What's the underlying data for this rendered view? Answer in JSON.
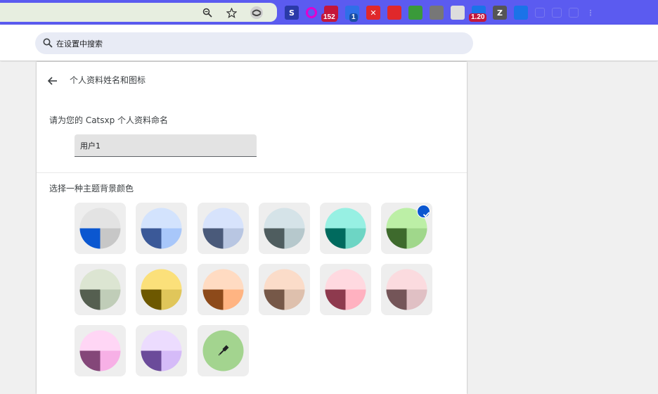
{
  "search": {
    "placeholder": "在设置中搜索"
  },
  "toolbar": {
    "extensions": [
      {
        "icon": "s-extension-icon",
        "color": "#2a3aa8",
        "text": "S"
      },
      {
        "icon": "ring-extension-icon",
        "color": "#e000d0",
        "text": ""
      },
      {
        "icon": "mail-extension-icon",
        "color": "#c4163a",
        "badge": "152"
      },
      {
        "icon": "folder-extension-icon",
        "color": "#2f6fe8",
        "badge": "1"
      },
      {
        "icon": "x-extension-icon",
        "color": "#e0282a",
        "text": "✕"
      },
      {
        "icon": "red-app-extension-icon",
        "color": "#e0282a",
        "text": ""
      },
      {
        "icon": "green-arrow-extension-icon",
        "color": "#3a9a3a",
        "text": ""
      },
      {
        "icon": "owl-extension-icon",
        "color": "#777777",
        "text": ""
      },
      {
        "icon": "bilibili-extension-icon",
        "color": "#dddddd",
        "text": ""
      },
      {
        "icon": "video-speed-extension-icon",
        "color": "#1a73e8",
        "badge": "1.20"
      },
      {
        "icon": "z-extension-icon",
        "color": "#555555",
        "text": "Z"
      },
      {
        "icon": "sync-extension-icon",
        "color": "#1a73e8",
        "text": ""
      },
      {
        "icon": "puzzle-extension-icon",
        "color": "#4d4de8",
        "text": ""
      },
      {
        "icon": "sidebar-icon",
        "color": "#4d4de8",
        "text": ""
      },
      {
        "icon": "download-icon",
        "color": "#4d4de8",
        "text": ""
      },
      {
        "icon": "more-menu-icon",
        "color": "#4d4de8",
        "text": "⋮"
      }
    ]
  },
  "page": {
    "title": "个人资料姓名和图标",
    "name_label": "请为您的 Catsxp 个人资料命名",
    "name_value": "用户1",
    "theme_label": "选择一种主题背景颜色"
  },
  "themes": [
    {
      "name": "default",
      "top": "#e3e3e3",
      "left": "#0b57d0",
      "right": "#c7c7c7",
      "selected": false
    },
    {
      "name": "light-blue",
      "top": "#d3e3fd",
      "left": "#3b5998",
      "right": "#a8c7fa",
      "selected": false
    },
    {
      "name": "periwinkle",
      "top": "#d7e3fc",
      "left": "#4a5a7a",
      "right": "#b8c6e2",
      "selected": false
    },
    {
      "name": "gray-blue",
      "top": "#d5e3e8",
      "left": "#4f5d5f",
      "right": "#b6c8cc",
      "selected": false
    },
    {
      "name": "aqua",
      "top": "#97f0e3",
      "left": "#006a5e",
      "right": "#6dd5c4",
      "selected": false
    },
    {
      "name": "green",
      "top": "#bcefa6",
      "left": "#3e6a2d",
      "right": "#a0d78b",
      "selected": true
    },
    {
      "name": "sage",
      "top": "#dce5d2",
      "left": "#555f50",
      "right": "#c0cdb8",
      "selected": false
    },
    {
      "name": "yellow",
      "top": "#fbe07a",
      "left": "#6d5800",
      "right": "#e0c65a",
      "selected": false
    },
    {
      "name": "orange",
      "top": "#ffdbc2",
      "left": "#8d4a1a",
      "right": "#ffb482",
      "selected": false
    },
    {
      "name": "tan",
      "top": "#fbdcc9",
      "left": "#765848",
      "right": "#dec0ad",
      "selected": false
    },
    {
      "name": "pink",
      "top": "#ffd9e0",
      "left": "#8e3a4e",
      "right": "#ffb1c0",
      "selected": false
    },
    {
      "name": "dusty-rose",
      "top": "#fbdbdf",
      "left": "#745558",
      "right": "#e0c0c4",
      "selected": false
    },
    {
      "name": "magenta",
      "top": "#ffd6f5",
      "left": "#844779",
      "right": "#f7b0e6",
      "selected": false
    },
    {
      "name": "lavender",
      "top": "#ecdcfe",
      "left": "#6b4b9a",
      "right": "#d5bbf8",
      "selected": false
    },
    {
      "name": "custom",
      "color": "#a3d48f",
      "selected": false
    }
  ]
}
